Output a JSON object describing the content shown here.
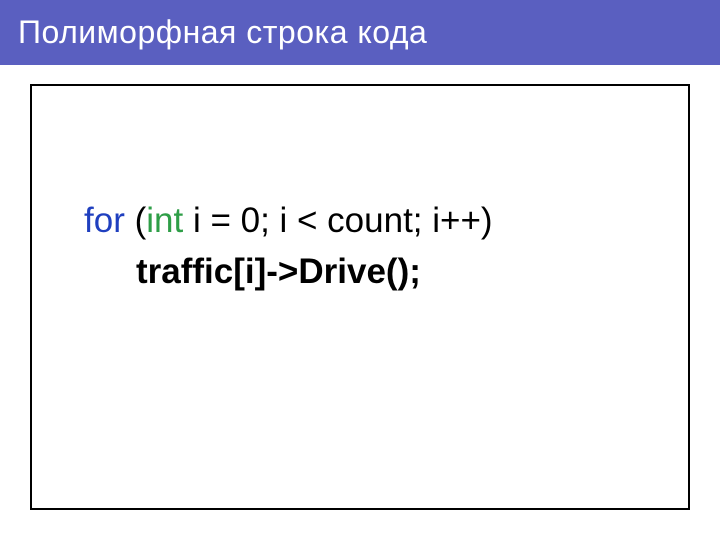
{
  "title": "Полиморфная строка кода",
  "code": {
    "kw_for": "for",
    "line1_paren_open": " (",
    "kw_int": "int",
    "line1_rest": " i = 0; i < count; i++)",
    "line2": "traffic[i]->Drive();"
  }
}
